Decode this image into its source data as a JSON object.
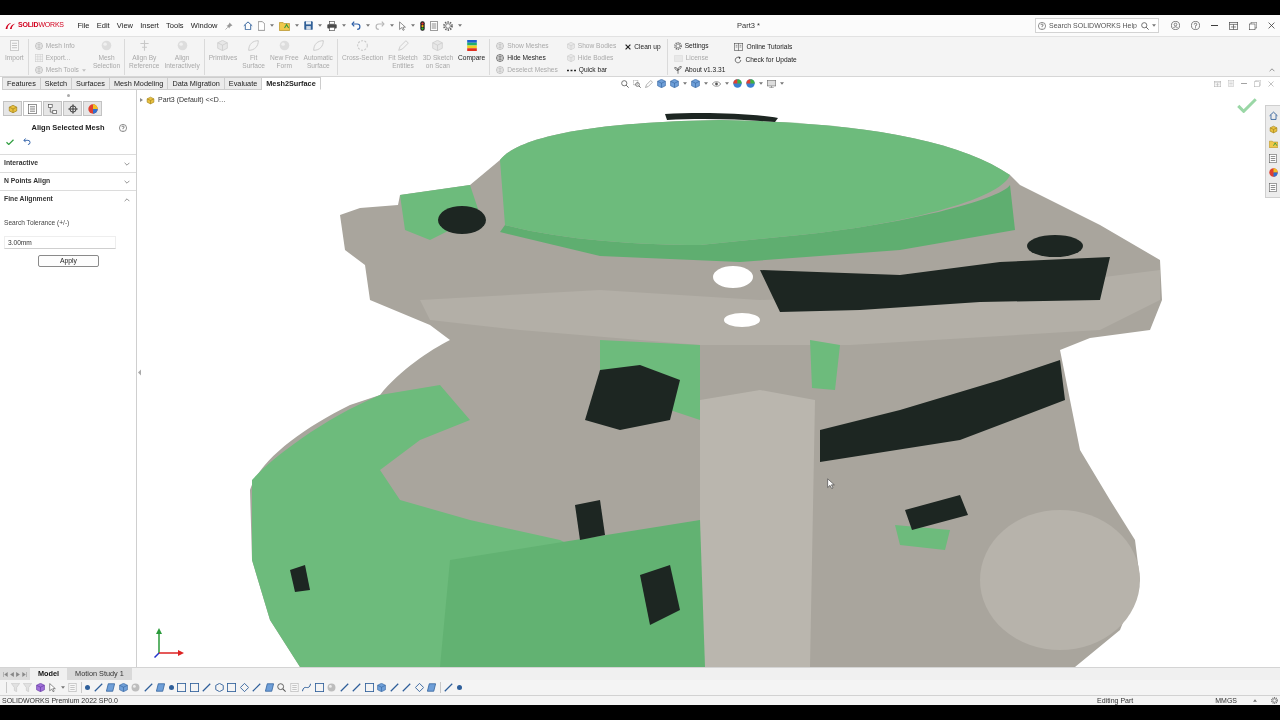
{
  "title_bar": {
    "logo": "**SOLID**WORKS",
    "menu": [
      "File",
      "Edit",
      "View",
      "Insert",
      "Tools",
      "Window"
    ],
    "document_title": "Part3 *",
    "search": {
      "placeholder": "Search SOLIDWORKS Help"
    }
  },
  "ribbon": {
    "groups": [
      {
        "columns": [
          {
            "kind": "large",
            "label": "Import",
            "disabled": true
          }
        ]
      },
      {
        "columns": [
          {
            "kind": "small",
            "items": [
              {
                "label": "Mesh Info",
                "disabled": true
              },
              {
                "label": "Export...",
                "disabled": true
              },
              {
                "label": "Mesh Tools",
                "disabled": true,
                "dropdown": true
              }
            ]
          },
          {
            "kind": "large",
            "label": "Mesh\nSelection",
            "disabled": true
          }
        ]
      },
      {
        "columns": [
          {
            "kind": "large",
            "label": "Align By\nReference",
            "disabled": true
          },
          {
            "kind": "large",
            "label": "Align\nInteractively",
            "disabled": true
          }
        ]
      },
      {
        "columns": [
          {
            "kind": "large",
            "label": "Primitives",
            "disabled": true
          },
          {
            "kind": "large",
            "label": "Fit\nSurface",
            "disabled": true
          },
          {
            "kind": "large",
            "label": "New Free\nForm",
            "disabled": true
          },
          {
            "kind": "large",
            "label": "Automatic\nSurface",
            "disabled": true
          }
        ]
      },
      {
        "columns": [
          {
            "kind": "large",
            "label": "Cross-Section",
            "disabled": true
          },
          {
            "kind": "large",
            "label": "Fit Sketch\nEntities",
            "disabled": true
          },
          {
            "kind": "large",
            "label": "3D Sketch\non Scan",
            "disabled": true
          },
          {
            "kind": "large",
            "label": "Compare",
            "disabled": false
          }
        ]
      },
      {
        "columns": [
          {
            "kind": "small",
            "items": [
              {
                "label": "Show Meshes",
                "disabled": true
              },
              {
                "label": "Hide Meshes",
                "disabled": false
              },
              {
                "label": "Deselect Meshes",
                "disabled": true
              }
            ]
          },
          {
            "kind": "small",
            "items": [
              {
                "label": "Show Bodies",
                "disabled": true
              },
              {
                "label": "Hide Bodies",
                "disabled": true
              },
              {
                "label": "Quick bar",
                "disabled": false
              }
            ]
          },
          {
            "kind": "small",
            "items": [
              {
                "label": "Clean up",
                "disabled": false
              }
            ]
          }
        ]
      },
      {
        "columns": [
          {
            "kind": "small",
            "items": [
              {
                "label": "Settings",
                "disabled": false
              },
              {
                "label": "License",
                "disabled": true
              },
              {
                "label": "About v1.3.31",
                "disabled": false
              }
            ]
          },
          {
            "kind": "small",
            "items": [
              {
                "label": "Online Tutorials",
                "disabled": false
              },
              {
                "label": "Check for Update",
                "disabled": false
              }
            ]
          }
        ]
      }
    ]
  },
  "tabs": [
    {
      "label": "Features",
      "selected": false
    },
    {
      "label": "Sketch",
      "selected": false
    },
    {
      "label": "Surfaces",
      "selected": false
    },
    {
      "label": "Mesh Modeling",
      "selected": false
    },
    {
      "label": "Data Migration",
      "selected": false
    },
    {
      "label": "Evaluate",
      "selected": false
    },
    {
      "label": "Mesh2Surface",
      "selected": true
    }
  ],
  "property_manager": {
    "tabs": [
      {
        "selected": false
      },
      {
        "selected": true
      },
      {
        "selected": false
      },
      {
        "selected": false
      },
      {
        "selected": false
      }
    ],
    "title": "Align Selected Mesh",
    "sections": [
      {
        "label": "Interactive",
        "expanded": false
      },
      {
        "label": "N Points Align",
        "expanded": false
      },
      {
        "label": "Fine Alignment",
        "expanded": true,
        "field_label": "Search Tolerance (+/-)",
        "value": "3.00mm",
        "button": "Apply"
      }
    ]
  },
  "viewport": {
    "tree_item": "Part3 (Default) <<D…"
  },
  "bottom_tabs": [
    {
      "label": "Model",
      "selected": true
    },
    {
      "label": "Motion Study 1",
      "selected": false
    }
  ],
  "status_bar": {
    "product": "SOLIDWORKS Premium 2022 SP0.0",
    "mode": "Editing Part",
    "units": "MMGS"
  }
}
